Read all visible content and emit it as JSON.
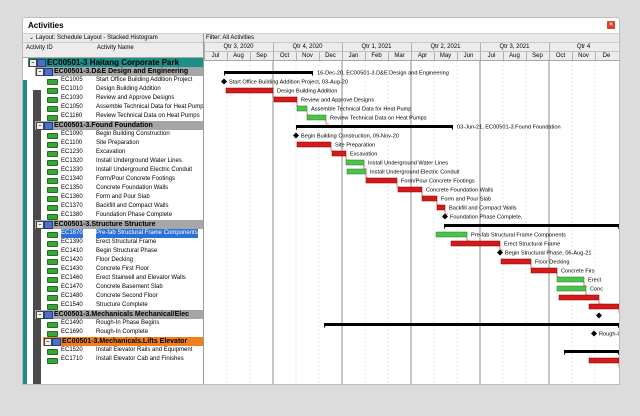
{
  "window": {
    "title": "Activities"
  },
  "left_panel": {
    "layout_label": "Layout: Schedule Layout - Stacked Histogram",
    "col_id": "Activity ID",
    "col_name": "Activity Name"
  },
  "right_panel": {
    "filter_label": "Filter: All Activities"
  },
  "timeline": {
    "quarters": [
      "Qtr 3, 2020",
      "Qtr 4, 2020",
      "Qtr 1, 2021",
      "Qtr 2, 2021",
      "Qtr 3, 2021",
      "Qtr 4"
    ],
    "months": [
      "Jul",
      "Aug",
      "Sep",
      "Oct",
      "Nov",
      "Dec",
      "Jan",
      "Feb",
      "Mar",
      "Apr",
      "May",
      "Jun",
      "Jul",
      "Aug",
      "Sep",
      "Oct",
      "Nov",
      "De"
    ]
  },
  "rows": [
    {
      "type": "wbs",
      "level": 0,
      "name": "EC00501-3 Haitang Corporate Park",
      "bg": "#1c8f8a"
    },
    {
      "type": "wbs",
      "level": 1,
      "name": "EC00501-3.D&E  Design and Engineering",
      "bg": "#a6a6a6"
    },
    {
      "type": "act",
      "id": "EC1005",
      "name": "Start Office Building Addition Project"
    },
    {
      "type": "act",
      "id": "EC1010",
      "name": "Design Building Addition"
    },
    {
      "type": "act",
      "id": "EC1030",
      "name": "Review and Approve Designs"
    },
    {
      "type": "act",
      "id": "EC1050",
      "name": "Assemble Technical Data for Heat Pump"
    },
    {
      "type": "act",
      "id": "EC1160",
      "name": "Review Technical Data on Heat Pumps"
    },
    {
      "type": "wbs",
      "level": 1,
      "name": "EC00501-3.Found  Foundation",
      "bg": "#a6a6a6"
    },
    {
      "type": "act",
      "id": "EC1090",
      "name": "Begin Building Construction"
    },
    {
      "type": "act",
      "id": "EC1100",
      "name": "Site Preparation"
    },
    {
      "type": "act",
      "id": "EC1230",
      "name": "Excavation"
    },
    {
      "type": "act",
      "id": "EC1320",
      "name": "Install Underground Water Lines"
    },
    {
      "type": "act",
      "id": "EC1330",
      "name": "Install Underground Electric Conduit"
    },
    {
      "type": "act",
      "id": "EC1340",
      "name": "Form/Pour Concrete Footings"
    },
    {
      "type": "act",
      "id": "EC1350",
      "name": "Concrete Foundation Walls"
    },
    {
      "type": "act",
      "id": "EC1360",
      "name": "Form and Pour Slab"
    },
    {
      "type": "act",
      "id": "EC1370",
      "name": "Backfill and Compact Walls"
    },
    {
      "type": "act",
      "id": "EC1380",
      "name": "Foundation Phase Complete"
    },
    {
      "type": "wbs",
      "level": 1,
      "name": "EC00501-3.Structure  Structure",
      "bg": "#a6a6a6"
    },
    {
      "type": "act",
      "id": "EC1870",
      "name": "Pre-fab Structural Frame Components",
      "selected": true
    },
    {
      "type": "act",
      "id": "EC1390",
      "name": "Erect Structural Frame"
    },
    {
      "type": "act",
      "id": "EC1410",
      "name": "Begin Structural Phase"
    },
    {
      "type": "act",
      "id": "EC1420",
      "name": "Floor Decking"
    },
    {
      "type": "act",
      "id": "EC1430",
      "name": "Concrete First Floor"
    },
    {
      "type": "act",
      "id": "EC1460",
      "name": "Erect Stairwell and Elevator Walls"
    },
    {
      "type": "act",
      "id": "EC1470",
      "name": "Concrete Basement Slab"
    },
    {
      "type": "act",
      "id": "EC1480",
      "name": "Concrete Second Floor"
    },
    {
      "type": "act",
      "id": "EC1540",
      "name": "Structure Complete"
    },
    {
      "type": "wbs",
      "level": 1,
      "name": "EC00501-3.Mechanicals  Mechanical/Elec",
      "bg": "#a6a6a6"
    },
    {
      "type": "act",
      "id": "EC1490",
      "name": "Rough-In Phase Begins"
    },
    {
      "type": "act",
      "id": "EC1690",
      "name": "Rough-In Complete"
    },
    {
      "type": "wbs",
      "level": 2,
      "name": "EC00501-3.Mechanicals.Lifts  Elevator",
      "bg": "#f07e1e"
    },
    {
      "type": "act",
      "id": "EC1520",
      "name": "Install Elevator Rails and Equipment"
    },
    {
      "type": "act",
      "id": "EC1710",
      "name": "Install Elevator Cab and Finishes"
    }
  ],
  "gantt_labels": [
    {
      "row": 1,
      "text": "16-Dec-20, EC00501-3.D&E  Design and Engineering"
    },
    {
      "row": 2,
      "text": "Start Office Building Addition Project, 03-Aug-20"
    },
    {
      "row": 3,
      "text": "Design Building Addition"
    },
    {
      "row": 4,
      "text": "Review and Approve Designs"
    },
    {
      "row": 5,
      "text": "Assemble Technical Data for Heat Pump"
    },
    {
      "row": 6,
      "text": "Review Technical Data on Heat Pumps"
    },
    {
      "row": 7,
      "text": "03-Jun-21, EC00501-3.Found  Foundation"
    },
    {
      "row": 8,
      "text": "Begin Building Construction, 09-Nov-20"
    },
    {
      "row": 9,
      "text": "Site Preparation"
    },
    {
      "row": 10,
      "text": "Excavation"
    },
    {
      "row": 11,
      "text": "Install Underground Water Lines"
    },
    {
      "row": 12,
      "text": "Install Underground Electric Conduit"
    },
    {
      "row": 13,
      "text": "Form/Pour Concrete Footings"
    },
    {
      "row": 14,
      "text": "Concrete Foundation Walls"
    },
    {
      "row": 15,
      "text": "Form and Pour Slab"
    },
    {
      "row": 16,
      "text": "Backfill and Compact Walls"
    },
    {
      "row": 17,
      "text": "Foundation Phase Complete,"
    },
    {
      "row": 19,
      "text": "Pre-fab Structural Frame Components"
    },
    {
      "row": 20,
      "text": "Erect Structural Frame"
    },
    {
      "row": 21,
      "text": "Begin Structural Phase, 06-Aug-21"
    },
    {
      "row": 22,
      "text": "Floor Decking"
    },
    {
      "row": 23,
      "text": "Concrete Firs"
    },
    {
      "row": 24,
      "text": "Erect"
    },
    {
      "row": 25,
      "text": "Conc"
    },
    {
      "row": 30,
      "text": "Rough-In"
    },
    {
      "row": 33,
      "text": "Inst"
    }
  ],
  "colors": {
    "critical": "#d61a1a",
    "noncritical": "#4cc24c",
    "summary": "#000000",
    "relationship": "#d61a1a"
  }
}
